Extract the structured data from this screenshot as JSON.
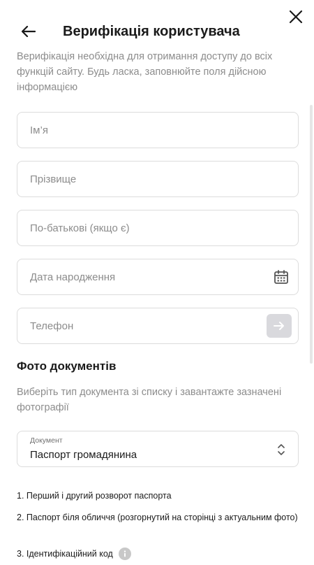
{
  "header": {
    "title": "Верифікація користувача",
    "back_icon": "arrow-left-icon",
    "close_icon": "close-icon"
  },
  "intro": "Верифікація необхідна для отримання доступу до всіх функцій сайту. Будь ласка, заповнюйте поля дійсною інформацією",
  "form": {
    "first_name": {
      "placeholder": "Ім’я",
      "value": ""
    },
    "last_name": {
      "placeholder": "Прізвище",
      "value": ""
    },
    "patronymic": {
      "placeholder": "По-батькові (якщо є)",
      "value": ""
    },
    "birth_date": {
      "placeholder": "Дата народження",
      "value": "",
      "icon": "calendar-icon"
    },
    "phone": {
      "placeholder": "Телефон",
      "value": "",
      "icon": "arrow-right-icon"
    }
  },
  "documents": {
    "title": "Фото документів",
    "description": "Виберіть тип документа зі списку і завантажте зазначені фотографії",
    "select": {
      "label": "Документ",
      "value": "Паспорт громадянина",
      "icon": "chevron-up-down-icon"
    },
    "requirements": [
      "1. Перший і другий розворот паспорта",
      "2. Паспорт біля обличчя (розгорнутий на сторінці з актуальним фото)",
      "3. Ідентифікаційний код"
    ],
    "info_icon": "info-icon"
  },
  "colors": {
    "text": "#1a1a1a",
    "muted": "#8c8c8c",
    "border": "#dcdcdc",
    "button_disabled": "#d9d9dd"
  }
}
